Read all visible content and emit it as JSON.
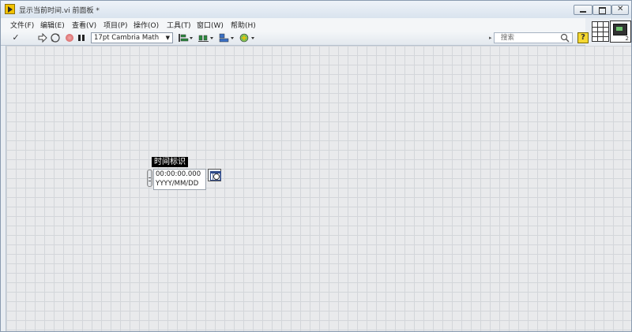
{
  "window": {
    "title": "显示当前时间.vi 前面板 *"
  },
  "menu": {
    "items": [
      "文件(F)",
      "编辑(E)",
      "查看(V)",
      "项目(P)",
      "操作(O)",
      "工具(T)",
      "窗口(W)",
      "帮助(H)"
    ]
  },
  "toolbar": {
    "run_glyph": "✓",
    "font_value": "17pt Cambria Math",
    "search_placeholder": "搜索"
  },
  "control": {
    "label": "时间标识",
    "time_value": "00:00:00.000",
    "date_value": "YYYY/MM/DD"
  },
  "vi_icon": {
    "badge": "2"
  },
  "colors": {
    "panel_background": "#e9eaec",
    "grid_line": "#d3d6da",
    "label_background": "#000000",
    "help_icon": "#f5d832"
  }
}
